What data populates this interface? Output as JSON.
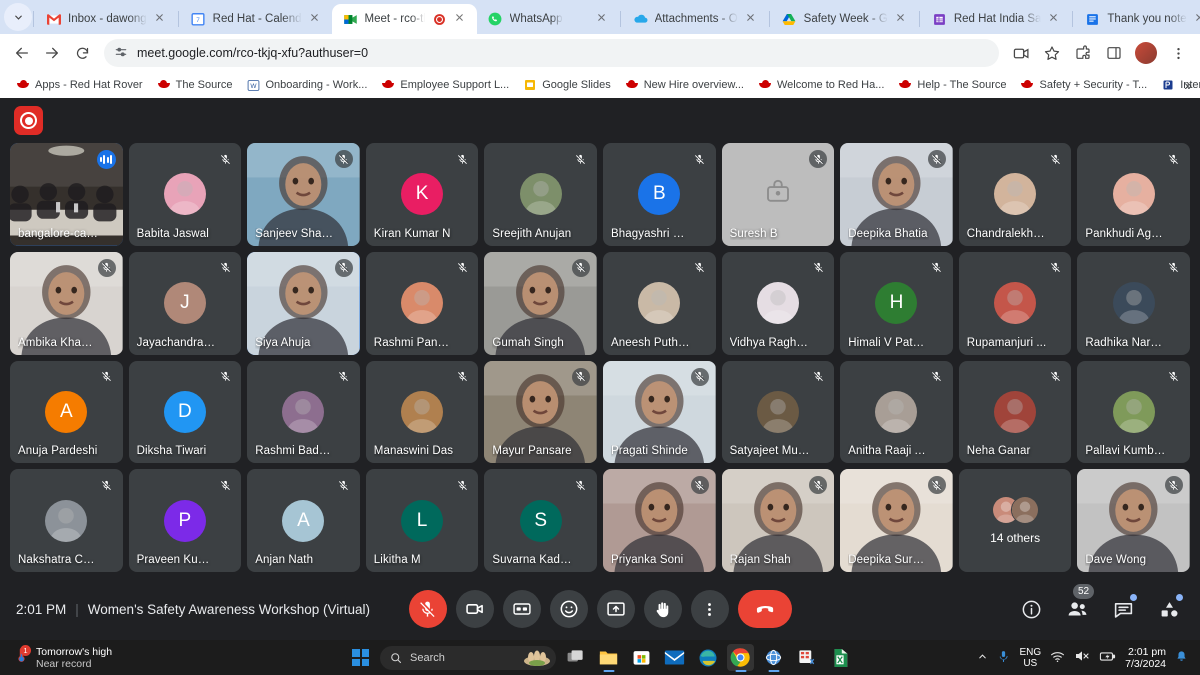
{
  "browser": {
    "tabs": [
      {
        "title": "Inbox - dawong",
        "icon": "gmail-icon",
        "active": false
      },
      {
        "title": "Red Hat - Calend",
        "icon": "calendar-icon",
        "active": false
      },
      {
        "title": "Meet - rco-tk",
        "icon": "meet-icon",
        "active": true,
        "recording": true
      },
      {
        "title": "WhatsApp",
        "icon": "whatsapp-icon",
        "active": false
      },
      {
        "title": "Attachments - O",
        "icon": "onedrive-icon",
        "active": false
      },
      {
        "title": "Safety Week - G",
        "icon": "gdrive-icon",
        "active": false
      },
      {
        "title": "Red Hat India Sa",
        "icon": "gsheets-icon",
        "active": false
      },
      {
        "title": "Thank you note",
        "icon": "gdocs-icon",
        "active": false
      }
    ],
    "url": "meet.google.com/rco-tkjq-xfu?authuser=0",
    "bookmarks": [
      {
        "label": "Apps - Red Hat Rover",
        "icon": "redhat-icon"
      },
      {
        "label": "The Source",
        "icon": "redhat-icon"
      },
      {
        "label": "Onboarding - Work...",
        "icon": "word-icon"
      },
      {
        "label": "Employee Support L...",
        "icon": "redhat-icon"
      },
      {
        "label": "Google Slides",
        "icon": "slides-icon"
      },
      {
        "label": "New Hire overview...",
        "icon": "redhat-icon"
      },
      {
        "label": "Welcome to Red Ha...",
        "icon": "redhat-icon"
      },
      {
        "label": "Help - The Source",
        "icon": "redhat-icon"
      },
      {
        "label": "Safety + Security - T...",
        "icon": "redhat-icon"
      },
      {
        "label": "International SOS M...",
        "icon": "sos-icon"
      }
    ],
    "bookmark_overflow": "»"
  },
  "meet": {
    "time": "2:01 PM",
    "separator": "|",
    "meeting_title": "Women's Safety Awareness Workshop (Virtual)",
    "participant_count": "52",
    "controls": [
      {
        "name": "microphone-button",
        "state": "muted",
        "style": "red"
      },
      {
        "name": "camera-button",
        "state": "off",
        "style": "grey"
      },
      {
        "name": "captions-button",
        "state": "off",
        "style": "grey"
      },
      {
        "name": "emoji-button",
        "state": "off",
        "style": "grey"
      },
      {
        "name": "present-button",
        "state": "off",
        "style": "grey"
      },
      {
        "name": "raise-hand-button",
        "state": "off",
        "style": "grey"
      },
      {
        "name": "more-options-button",
        "state": "off",
        "style": "grey"
      },
      {
        "name": "end-call-button",
        "state": "active",
        "style": "hang"
      }
    ],
    "participants": [
      {
        "name": "bangalore-car...",
        "type": "video",
        "muted": false,
        "speaking": true,
        "bg": "#35302c"
      },
      {
        "name": "Babita Jaswal",
        "type": "avatar-photo",
        "muted": true,
        "av": "#e8a3b8"
      },
      {
        "name": "Sanjeev Sharma",
        "type": "video",
        "muted": true,
        "bg": "#7fa8c0"
      },
      {
        "name": "Kiran Kumar N",
        "type": "initial",
        "initial": "K",
        "muted": true,
        "color": "#e91e63"
      },
      {
        "name": "Sreejith Anujan",
        "type": "avatar-photo",
        "muted": true,
        "av": "#7d8f6a"
      },
      {
        "name": "Bhagyashri Ma...",
        "type": "initial",
        "initial": "B",
        "muted": true,
        "color": "#1a73e8"
      },
      {
        "name": "Suresh B",
        "type": "placeholder",
        "muted": true,
        "tilebg": "#bdbdbd"
      },
      {
        "name": "Deepika Bhatia",
        "type": "video",
        "muted": true,
        "bg": "#c7cdd4"
      },
      {
        "name": "Chandralekha ...",
        "type": "avatar-photo",
        "muted": true,
        "av": "#d2b49c"
      },
      {
        "name": "Pankhudi Agra...",
        "type": "avatar-photo",
        "muted": true,
        "av": "#e6b0a0"
      },
      {
        "name": "Ambika Khanna",
        "type": "video",
        "muted": true,
        "bg": "#d8d4d0"
      },
      {
        "name": "Jayachandra P...",
        "type": "initial",
        "initial": "J",
        "muted": true,
        "color": "#b08878"
      },
      {
        "name": "Siya Ahuja",
        "type": "video",
        "muted": true,
        "speaking": true,
        "bg": "#c9d4dd"
      },
      {
        "name": "Rashmi Panch...",
        "type": "avatar-photo",
        "muted": true,
        "av": "#d98a6a"
      },
      {
        "name": "Gumah Singh",
        "type": "video",
        "muted": true,
        "bg": "#9a9a96"
      },
      {
        "name": "Aneesh Puthiy...",
        "type": "avatar-photo",
        "muted": true,
        "av": "#c9b9a6"
      },
      {
        "name": "Vidhya Raghu...",
        "type": "avatar-photo",
        "muted": true,
        "av": "#e5dde3"
      },
      {
        "name": "Himali V Patha...",
        "type": "initial",
        "initial": "H",
        "muted": true,
        "color": "#2e7d32"
      },
      {
        "name": "Rupamanjuri ...",
        "type": "avatar-photo",
        "muted": true,
        "av": "#c4564a"
      },
      {
        "name": "Radhika Nargo...",
        "type": "avatar-photo",
        "muted": true,
        "av": "#3b4a5a"
      },
      {
        "name": "Anuja Pardeshi",
        "type": "initial",
        "initial": "A",
        "muted": true,
        "color": "#f57c00"
      },
      {
        "name": "Diksha Tiwari",
        "type": "initial",
        "initial": "D",
        "muted": true,
        "color": "#2196f3"
      },
      {
        "name": "Rashmi Badag...",
        "type": "avatar-photo",
        "muted": true,
        "av": "#8d6e8f"
      },
      {
        "name": "Manaswini Das",
        "type": "avatar-photo",
        "muted": true,
        "av": "#b0804f"
      },
      {
        "name": "Mayur Pansare",
        "type": "video",
        "muted": true,
        "bg": "#8e8575"
      },
      {
        "name": "Pragati Shinde",
        "type": "video",
        "muted": true,
        "bg": "#cfd8de"
      },
      {
        "name": "Satyajeet Munje",
        "type": "avatar-photo",
        "muted": true,
        "av": "#6b5a44"
      },
      {
        "name": "Anitha Raaji Al...",
        "type": "avatar-photo",
        "muted": true,
        "av": "#a89e96"
      },
      {
        "name": "Neha Ganar",
        "type": "avatar-photo",
        "muted": true,
        "av": "#a0443a"
      },
      {
        "name": "Pallavi Kumbhar",
        "type": "avatar-photo",
        "muted": true,
        "av": "#7f9a5a"
      },
      {
        "name": "Nakshatra Ch...",
        "type": "avatar-photo",
        "muted": true,
        "av": "#8c9299"
      },
      {
        "name": "Praveen Kuma...",
        "type": "initial",
        "initial": "P",
        "muted": true,
        "color": "#7c2ae8"
      },
      {
        "name": "Anjan Nath",
        "type": "initial",
        "initial": "A",
        "muted": true,
        "color": "#a6c5d4"
      },
      {
        "name": "Likitha M",
        "type": "initial",
        "initial": "L",
        "muted": true,
        "color": "#00695c"
      },
      {
        "name": "Suvarna Kadam",
        "type": "initial",
        "initial": "S",
        "muted": true,
        "color": "#00695c"
      },
      {
        "name": "Priyanka Soni",
        "type": "video",
        "muted": true,
        "bg": "#b09a94"
      },
      {
        "name": "Rajan Shah",
        "type": "video",
        "muted": true,
        "bg": "#cdc6bd"
      },
      {
        "name": "Deepika Surya...",
        "type": "video",
        "muted": true,
        "bg": "#e4dcd2"
      },
      {
        "name": "14 others",
        "type": "others",
        "muted": false,
        "faces": [
          "#c98b7a",
          "#8b6f5e"
        ]
      },
      {
        "name": "Dave Wong",
        "type": "video",
        "muted": true,
        "bg": "#c2c2c2"
      }
    ]
  },
  "taskbar": {
    "weather_line1": "Tomorrow's high",
    "weather_line2": "Near record",
    "search_placeholder": "Search",
    "apps": [
      {
        "name": "task-view-icon",
        "running": false
      },
      {
        "name": "file-explorer-icon",
        "running": true
      },
      {
        "name": "microsoft-store-icon",
        "running": false
      },
      {
        "name": "mail-icon",
        "running": false
      },
      {
        "name": "edge-icon",
        "running": false
      },
      {
        "name": "chrome-icon",
        "running": true,
        "active": true
      },
      {
        "name": "network-app-icon",
        "running": true
      },
      {
        "name": "snipping-tool-icon",
        "running": false
      },
      {
        "name": "excel-icon",
        "running": false
      }
    ],
    "language": "ENG",
    "language_region": "US",
    "time": "2:01 pm",
    "date": "7/3/2024"
  }
}
